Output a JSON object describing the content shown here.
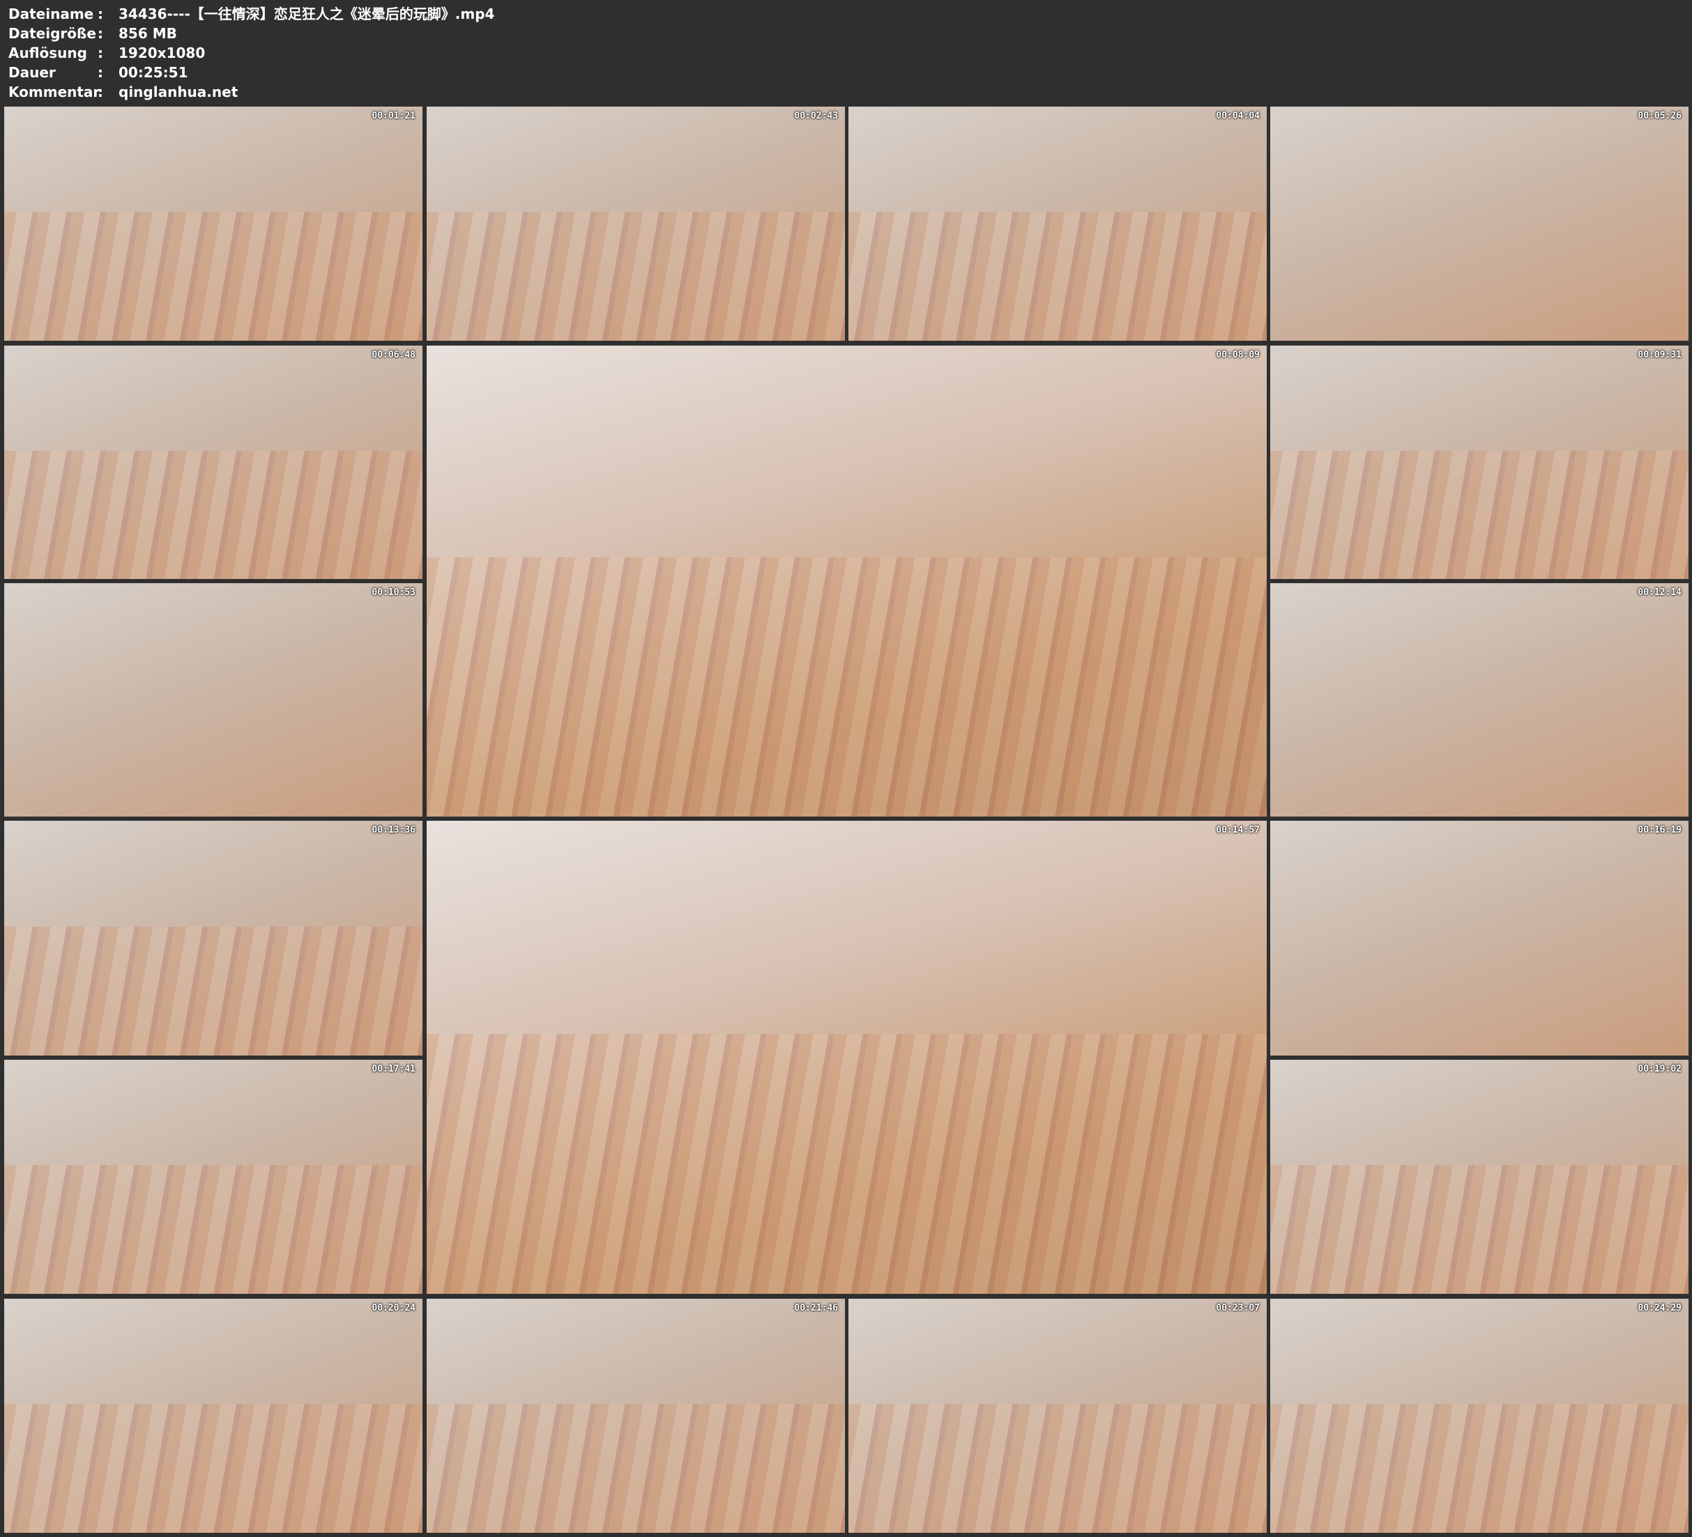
{
  "info": {
    "rows": [
      {
        "key": "Dateiname",
        "sep": ":",
        "value": "34436----【一往情深】恋足狂人之《迷晕后的玩脚》.mp4"
      },
      {
        "key": "Dateigröße",
        "sep": ":",
        "value": "856 MB"
      },
      {
        "key": "Auflösung",
        "sep": ":",
        "value": "1920x1080"
      },
      {
        "key": "Dauer",
        "sep": ":",
        "value": "00:25:51"
      },
      {
        "key": "Kommentar",
        "sep": ":",
        "value": "qinglanhua.net"
      }
    ]
  },
  "thumbnails": [
    {
      "time": "00:01:21"
    },
    {
      "time": "00:02:43"
    },
    {
      "time": "00:04:04"
    },
    {
      "time": "00:05:26"
    },
    {
      "time": "00:06:48"
    },
    {
      "time": "00:08:09"
    },
    {
      "time": "00:09:31"
    },
    {
      "time": "00:10:53"
    },
    {
      "time": "00:12:14"
    },
    {
      "time": "00:13:36"
    },
    {
      "time": "00:14:57"
    },
    {
      "time": "00:16:19"
    },
    {
      "time": "00:17:41"
    },
    {
      "time": "00:19:02"
    },
    {
      "time": "00:20:24"
    },
    {
      "time": "00:21:46"
    },
    {
      "time": "00:23:07"
    },
    {
      "time": "00:24:29"
    }
  ]
}
